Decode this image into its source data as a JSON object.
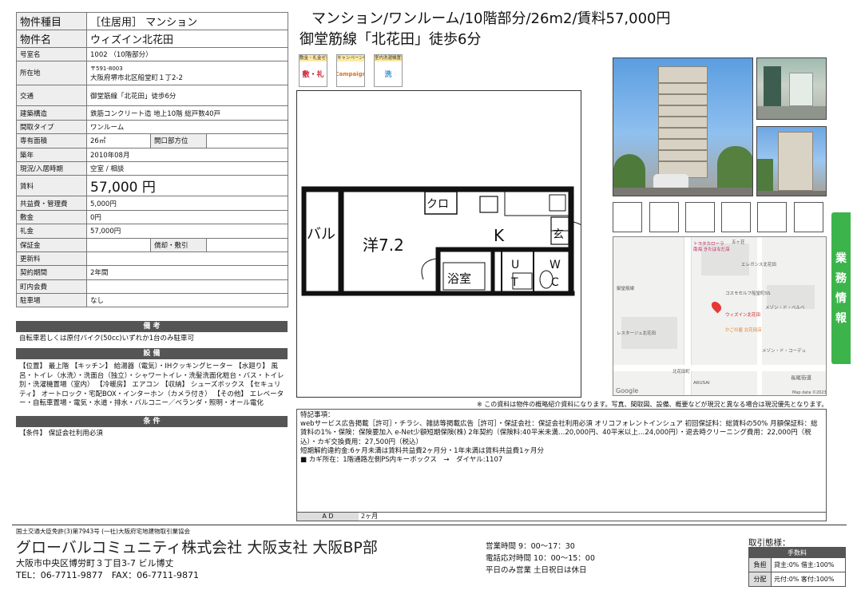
{
  "props": [
    {
      "label": "物件種目",
      "value": "［住居用］ マンション",
      "cls": "big"
    },
    {
      "label": "物件名",
      "value": "ウィズイン北花田",
      "cls": "big"
    },
    {
      "label": "号室名",
      "value": "1002 （10階部分）"
    },
    {
      "label": "所在地",
      "value_small": "〒591-8003",
      "value": "大阪府堺市北区船堂町１丁2-2",
      "cls": "addr"
    },
    {
      "label": "交通",
      "value": "御堂筋線「北花田」徒歩6分",
      "cls": "tall"
    },
    {
      "label": "建築構造",
      "value": "鉄筋コンクリート造 地上10階 総戸数40戸"
    },
    {
      "label": "間取タイプ",
      "value": "ワンルーム"
    },
    {
      "label": "専有面積",
      "value": "26㎡",
      "sub_label": "開口部方位",
      "sub_value": ""
    },
    {
      "label": "築年",
      "value": "2010年08月"
    },
    {
      "label": "現況/入居時期",
      "value": "空室 / 相談"
    },
    {
      "label": "賃料",
      "value": "57,000 円",
      "cls": "rent"
    },
    {
      "label": "共益費・管理費",
      "value": "5,000円"
    },
    {
      "label": "敷金",
      "value": "0円"
    },
    {
      "label": "礼金",
      "value": "57,000円"
    },
    {
      "label": "保証金",
      "value": "",
      "sub_label": "償却・敷引",
      "sub_value": ""
    },
    {
      "label": "更新料",
      "value": ""
    },
    {
      "label": "契約期間",
      "value": "2年間"
    },
    {
      "label": "町内会費",
      "value": ""
    },
    {
      "label": "駐車場",
      "value": "なし"
    }
  ],
  "sections": {
    "remarks_title": "備 考",
    "remarks_text": "自転車若しくは原付バイク(50cc)いずれか1台のみ駐車可",
    "equipment_title": "設 備",
    "equipment_text": "【位置】 最上階 【キッチン】 給湯器（電気）・IHクッキングヒーター 【水廻り】 風呂・トイレ（水洗）・洗面台（独立）・シャワートイレ・洗髪洗面化粧台・バス・トイレ別・洗濯機置場（室内） 【冷暖房】 エアコン 【収納】 シューズボックス 【セキュリティ】 オートロック・宅配BOX・インターホン（カメラ付き） 【その他】 エレベーター・自転車置場・電気・水道・排水・バルコニー／ベランダ・照明・オール電化",
    "conditions_title": "条 件",
    "conditions_text": "【条件】 保証会社利用必須"
  },
  "header": {
    "title_line1": "マンション/ワンルーム/10階部分/26m2/賃料57,000円",
    "title_line2": "御堂筋線「北花田」徒歩6分"
  },
  "badges": [
    {
      "top": "敷金・礼金ゼロ",
      "icon": "敷・礼"
    },
    {
      "top": "キャンペーン中",
      "icon": "Campaign"
    },
    {
      "top": "室内洗濯機置場",
      "icon": "洗"
    }
  ],
  "floorplan": {
    "room_label": "洋7.2",
    "balcony_label": "バル\nコニー",
    "balcony_short": "バル",
    "closet_label": "クロ",
    "kitchen_label": "K",
    "entrance_label": "玄",
    "bath_label": "浴室",
    "ut_label": "U\nT",
    "wc_label": "W\nC"
  },
  "side_tab": [
    "業",
    "務",
    "情",
    "報"
  ],
  "map": {
    "labels": [
      "トヨタカローラ",
      "南海 きたはなだ店",
      "エレガンス北花田",
      "御堂筋線",
      "コスモセルフ船堂町SS",
      "ウィズイン北花田",
      "メゾン・ド・ベルベ",
      "かごの屋 北花田店",
      "レスタージュ北花田",
      "メゾン・ド・コーデュ",
      "長尾街道",
      "ARUSAI",
      "Map data ©2023",
      "五ヶ荘",
      "北花田町"
    ],
    "google_label": "Google"
  },
  "notice": "※ この資料は物件の概略紹介資料になります。写真、間取図、設備、概要などが現況と異なる場合は現況優先となります。",
  "notes": {
    "title": "特記事項：",
    "text": "webサービス広告掲載［許可］・チラシ、雑誌等掲載広告［許可］・保証会社：保証会社利用必須 オリコフォレントインシュア 初回保証料：総賃料の50% 月額保証料：総賃料の1%・保険：保険要加入 e-Net少額短期保険(株) 2年契約（保険料:40平米未満…20,000円、40平米以上…24,000円）・退去時クリーニング費用：22,000円（税込）・カギ交換費用：27,500円（税込）\n短期解約違約金:6ヶ月未満は賃料共益費2ヶ月分・1年未満は賃料共益費1ヶ月分\n■ カギ所在：1階通路左側PS内キーボックス　→　ダイヤル:1107"
  },
  "ad": {
    "label": "A D",
    "value": "2ヶ月"
  },
  "footer": {
    "license": "国土交通大臣免許(3)第7943号 (一社)大阪府宅地建物取引業協会",
    "company": "グローバルコミュニティ株式会社 大阪支社 大阪BP部",
    "address": "大阪市中央区博労町３丁目3-7 ビル博丈",
    "tel": "TEL：06-7711-9877　FAX：06-7711-9871",
    "hours1": "営業時間 9：00〜17：30",
    "hours2": "電話応対時間 10：00〜15：00",
    "hours3": "平日のみ営業 土日祝日は休日"
  },
  "terms": {
    "title": "取引態様：",
    "header": "手数料",
    "rows": [
      {
        "label": "負担",
        "value": "貸主:0% 借主:100%"
      },
      {
        "label": "分配",
        "value": "元付:0% 客付:100%"
      }
    ]
  }
}
